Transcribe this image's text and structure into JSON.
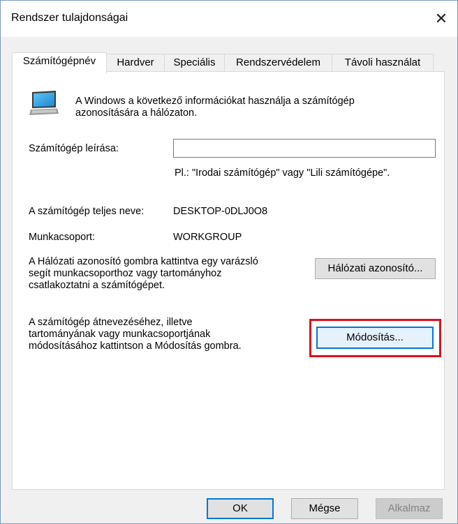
{
  "window": {
    "title": "Rendszer tulajdonságai",
    "close_glyph": "✕"
  },
  "tabs": [
    {
      "label": "Számítógépnév"
    },
    {
      "label": "Hardver"
    },
    {
      "label": "Speciális"
    },
    {
      "label": "Rendszervédelem"
    },
    {
      "label": "Távoli használat"
    }
  ],
  "info": {
    "icon": "computer-monitor-icon",
    "text_line1": "A Windows a következő információkat használja a számítógép",
    "text_line2": "azonosítására a hálózaton."
  },
  "description": {
    "label": "Számítógép leírása:",
    "value": "",
    "hint": "Pl.: \"Irodai számítógép\" vagy \"Lili számítógépe\"."
  },
  "full_name": {
    "label": "A számítógép teljes neve:",
    "value": "DESKTOP-0DLJ0O8"
  },
  "workgroup": {
    "label": "Munkacsoport:",
    "value": "WORKGROUP"
  },
  "network_id": {
    "line1": "A Hálózati azonosító gombra kattintva egy varázsló",
    "line2": "segít munkacsoporthoz vagy tartományhoz",
    "line3": "csatlakoztatni a számítógépet.",
    "button": "Hálózati azonosító..."
  },
  "rename": {
    "line1": "A számítógép átnevezéséhez, illetve",
    "line2": "tartományának vagy munkacsoportjának",
    "line3": "módosításához kattintson a Módosítás gombra.",
    "button": "Módosítás..."
  },
  "footer": {
    "ok": "OK",
    "cancel": "Mégse",
    "apply": "Alkalmaz"
  },
  "colors": {
    "highlight": "#e0101c",
    "focus": "#0078d7"
  }
}
